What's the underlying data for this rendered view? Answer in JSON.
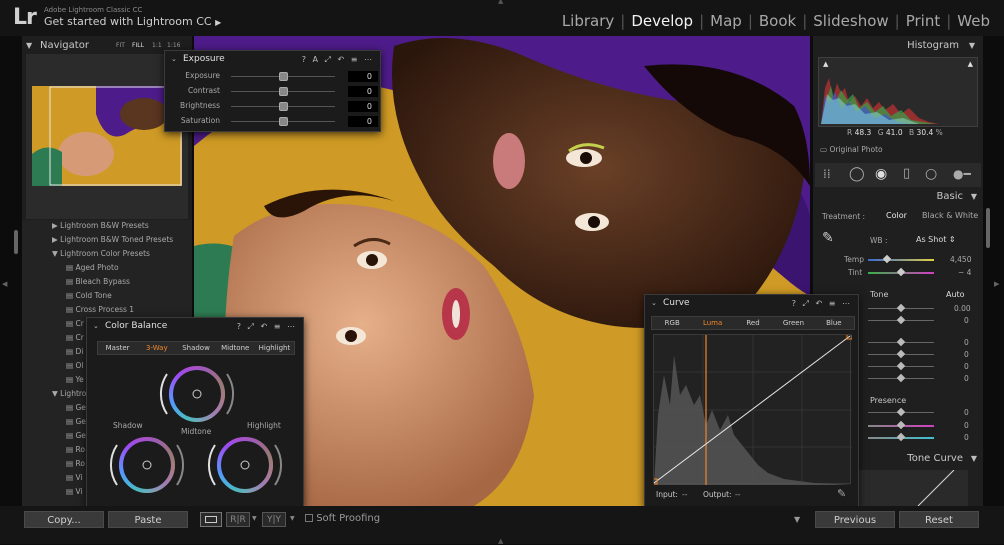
{
  "app": {
    "title": "Adobe Lightroom Classic CC",
    "subtitle": "Get started with Lightroom CC",
    "logo": "Lr"
  },
  "modules": [
    "Library",
    "Develop",
    "Map",
    "Book",
    "Slideshow",
    "Print",
    "Web"
  ],
  "active_module": "Develop",
  "navigator": {
    "title": "Navigator",
    "zoom_options": [
      "FIT",
      "FILL",
      "1:1",
      "1:16"
    ]
  },
  "presets": [
    {
      "label": "Lightroom B&W Presets",
      "type": "folder"
    },
    {
      "label": "Lightroom B&W Toned Presets",
      "type": "folder"
    },
    {
      "label": "Lightroom Color Presets",
      "type": "folder-open"
    },
    {
      "label": "Aged Photo",
      "type": "item"
    },
    {
      "label": "Bleach Bypass",
      "type": "item"
    },
    {
      "label": "Cold Tone",
      "type": "item"
    },
    {
      "label": "Cross Process 1",
      "type": "item"
    },
    {
      "label": "Cr",
      "type": "item"
    },
    {
      "label": "Cr",
      "type": "item"
    },
    {
      "label": "Di",
      "type": "item"
    },
    {
      "label": "Ol",
      "type": "item"
    },
    {
      "label": "Ye",
      "type": "item"
    },
    {
      "label": "Lightro",
      "type": "folder-open"
    },
    {
      "label": "Ge",
      "type": "item"
    },
    {
      "label": "Ge",
      "type": "item"
    },
    {
      "label": "Ge",
      "type": "item"
    },
    {
      "label": "Ro",
      "type": "item"
    },
    {
      "label": "Ro",
      "type": "item"
    },
    {
      "label": "Vi",
      "type": "item"
    },
    {
      "label": "Vi",
      "type": "item"
    }
  ],
  "exposure_panel": {
    "title": "Exposure",
    "sliders": [
      {
        "label": "Exposure",
        "value": "0"
      },
      {
        "label": "Contrast",
        "value": "0"
      },
      {
        "label": "Brightness",
        "value": "0"
      },
      {
        "label": "Saturation",
        "value": "0"
      }
    ]
  },
  "color_balance": {
    "title": "Color Balance",
    "tabs": [
      "Master",
      "3-Way",
      "Shadow",
      "Midtone",
      "Highlight"
    ],
    "active_tab": "3-Way",
    "wheels": [
      "Shadow",
      "Midtone",
      "Highlight"
    ]
  },
  "curve": {
    "title": "Curve",
    "tabs": [
      "RGB",
      "Luma",
      "Red",
      "Green",
      "Blue"
    ],
    "active_tab": "Luma",
    "input_label": "Input:",
    "output_label": "Output:",
    "input_value": "--",
    "output_value": "--"
  },
  "histogram": {
    "title": "Histogram",
    "r_label": "R",
    "r": "48.3",
    "g_label": "G",
    "g": "41.0",
    "b_label": "B",
    "b": "30.4",
    "unit": "%",
    "original_photo": "Original Photo"
  },
  "basic": {
    "title": "Basic",
    "treatment_label": "Treatment :",
    "treatment_options": [
      "Color",
      "Black & White"
    ],
    "wb_label": "WB :",
    "wb_value": "As Shot",
    "temp_label": "Temp",
    "temp_value": "4,450",
    "tint_label": "Tint",
    "tint_value": "− 4",
    "tone_label": "Tone",
    "tone_auto": "Auto",
    "tone_values": [
      "0.00",
      "0",
      "0",
      "0",
      "0",
      "0"
    ],
    "presence_label": "Presence",
    "presence_values": [
      "0",
      "0",
      "0"
    ]
  },
  "tone_curve": {
    "title": "Tone Curve"
  },
  "bottom": {
    "copy": "Copy...",
    "paste": "Paste",
    "soft_proofing": "Soft Proofing",
    "previous": "Previous",
    "reset": "Reset",
    "yy": "Y|Y"
  },
  "colors": {
    "accent": "#f0862a",
    "panel": "#1e1e1e",
    "photo_bg": "#cf9a25",
    "purple": "#4e1c8a"
  }
}
